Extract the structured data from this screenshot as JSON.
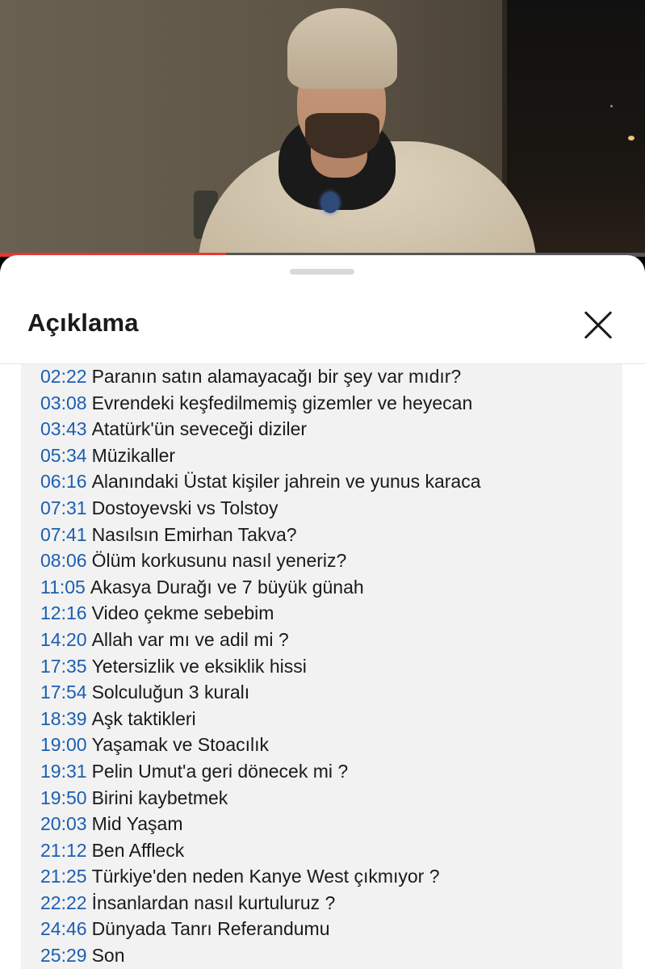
{
  "video": {
    "progress_fraction": 0.35,
    "progress_color": "#e53935"
  },
  "sheet": {
    "title": "Açıklama",
    "close_icon": "close-x-icon"
  },
  "chapters": [
    {
      "time": "02:22",
      "title": "Paranın satın alamayacağı bir şey var mıdır?"
    },
    {
      "time": "03:08",
      "title": "Evrendeki keşfedilmemiş gizemler ve heyecan"
    },
    {
      "time": "03:43",
      "title": "Atatürk'ün seveceği diziler"
    },
    {
      "time": "05:34",
      "title": "Müzikaller"
    },
    {
      "time": "06:16",
      "title": "Alanındaki Üstat kişiler jahrein ve yunus karaca"
    },
    {
      "time": "07:31",
      "title": "Dostoyevski vs Tolstoy"
    },
    {
      "time": "07:41",
      "title": "Nasılsın Emirhan Takva?"
    },
    {
      "time": "08:06",
      "title": "Ölüm korkusunu nasıl yeneriz?"
    },
    {
      "time": "11:05",
      "title": "Akasya Durağı ve 7 büyük günah"
    },
    {
      "time": "12:16",
      "title": "Video çekme sebebim"
    },
    {
      "time": "14:20",
      "title": "Allah var mı ve adil mi ?"
    },
    {
      "time": "17:35",
      "title": "Yetersizlik ve eksiklik hissi"
    },
    {
      "time": "17:54",
      "title": "Solculuğun 3 kuralı"
    },
    {
      "time": "18:39",
      "title": "Aşk taktikleri"
    },
    {
      "time": "19:00",
      "title": "Yaşamak ve Stoacılık"
    },
    {
      "time": "19:31",
      "title": "Pelin Umut'a geri dönecek mi ?"
    },
    {
      "time": "19:50",
      "title": "Birini kaybetmek"
    },
    {
      "time": "20:03",
      "title": "Mid Yaşam"
    },
    {
      "time": "21:12",
      "title": "Ben Affleck"
    },
    {
      "time": "21:25",
      "title": "Türkiye'den neden Kanye West çıkmıyor ?"
    },
    {
      "time": "22:22",
      "title": "İnsanlardan nasıl kurtuluruz ?"
    },
    {
      "time": "24:46",
      "title": "Dünyada Tanrı Referandumu"
    },
    {
      "time": "25:29",
      "title": "Son"
    }
  ]
}
